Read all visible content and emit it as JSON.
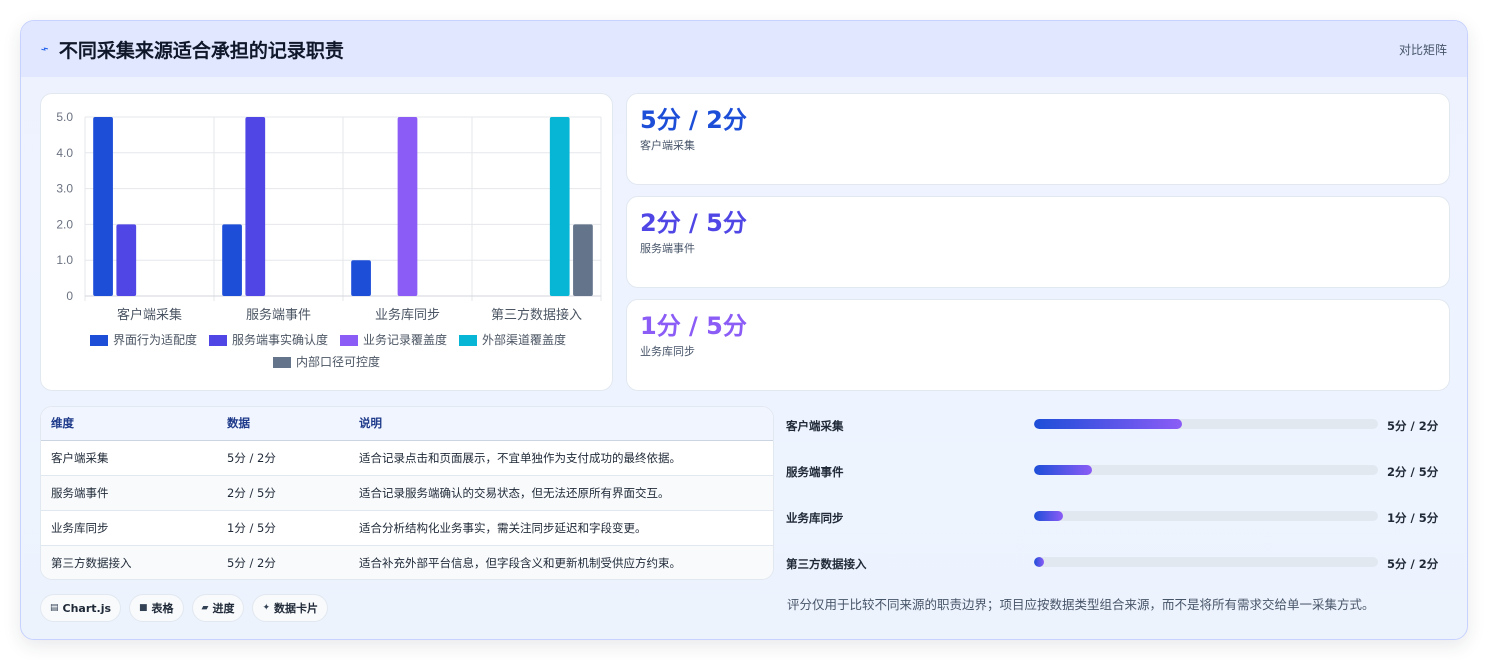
{
  "header": {
    "icon": "bolt-icon",
    "title": "不同采集来源适合承担的记录职责",
    "mode_label": "对比矩阵"
  },
  "chart_data": {
    "type": "bar",
    "categories": [
      "客户端采集",
      "服务端事件",
      "业务库同步",
      "第三方数据接入"
    ],
    "series": [
      {
        "name": "界面行为适配度",
        "color": "#1d4ed8",
        "values": [
          5,
          2,
          1,
          0
        ]
      },
      {
        "name": "服务端事实确认度",
        "color": "#4f46e5",
        "values": [
          2,
          5,
          0,
          0
        ]
      },
      {
        "name": "业务记录覆盖度",
        "color": "#8b5cf6",
        "values": [
          0,
          0,
          5,
          0
        ]
      },
      {
        "name": "外部渠道覆盖度",
        "color": "#06b6d4",
        "values": [
          0,
          0,
          0,
          5
        ]
      },
      {
        "name": "内部口径可控度",
        "color": "#64748b",
        "values": [
          0,
          0,
          0,
          2
        ]
      }
    ],
    "ylim": [
      0,
      5
    ],
    "yticks": [
      "0",
      "1.0",
      "2.0",
      "3.0",
      "4.0",
      "5.0"
    ],
    "grid": true,
    "legend": "bottom"
  },
  "stats": [
    {
      "value": "5分 / 2分",
      "label": "客户端采集",
      "color": "#1d4ed8"
    },
    {
      "value": "2分 / 5分",
      "label": "服务端事件",
      "color": "#4f46e5"
    },
    {
      "value": "1分 / 5分",
      "label": "业务库同步",
      "color": "#8b5cf6"
    }
  ],
  "table": {
    "headers": [
      "维度",
      "数据",
      "说明"
    ],
    "rows": [
      [
        "客户端采集",
        "5分 / 2分",
        "适合记录点击和页面展示，不宜单独作为支付成功的最终依据。"
      ],
      [
        "服务端事件",
        "2分 / 5分",
        "适合记录服务端确认的交易状态，但无法还原所有界面交互。"
      ],
      [
        "业务库同步",
        "1分 / 5分",
        "适合分析结构化业务事实，需关注同步延迟和字段变更。"
      ],
      [
        "第三方数据接入",
        "5分 / 2分",
        "适合补充外部平台信息，但字段含义和更新机制受供应方约束。"
      ]
    ]
  },
  "progress": [
    {
      "label": "客户端采集",
      "value": "5分 / 2分",
      "fraction": 0.43
    },
    {
      "label": "服务端事件",
      "value": "2分 / 5分",
      "fraction": 0.17
    },
    {
      "label": "业务库同步",
      "value": "1分 / 5分",
      "fraction": 0.085
    },
    {
      "label": "第三方数据接入",
      "value": "5分 / 2分",
      "fraction": 0.03
    }
  ],
  "tags": [
    {
      "icon": "chart-icon",
      "label": "Chart.js"
    },
    {
      "icon": "table-icon",
      "label": "表格"
    },
    {
      "icon": "progress-icon",
      "label": "进度"
    },
    {
      "icon": "sparkle-icon",
      "label": "数据卡片"
    }
  ],
  "footnote": "评分仅用于比较不同来源的职责边界；项目应按数据类型组合来源，而不是将所有需求交给单一采集方式。"
}
